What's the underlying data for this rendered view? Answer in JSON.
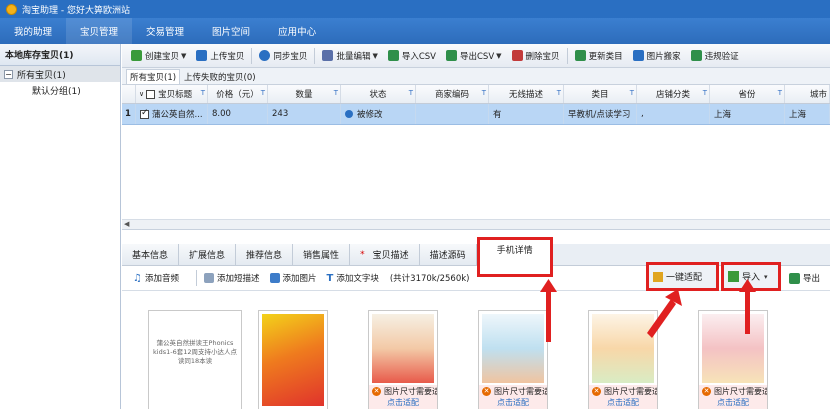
{
  "app": {
    "title": "淘宝助理 - 您好大箅欧洲站"
  },
  "menu": [
    {
      "label": "我的助理"
    },
    {
      "label": "宝贝管理"
    },
    {
      "label": "交易管理"
    },
    {
      "label": "图片空间"
    },
    {
      "label": "应用中心"
    }
  ],
  "left_panel": {
    "header": "本地库存宝贝(1)",
    "tree": {
      "root": "所有宝贝(1)",
      "root_toggle": "−",
      "child": "默认分组(1)"
    }
  },
  "toolbar": [
    {
      "label": "创建宝贝",
      "icon": "plus-icon",
      "color": "#3a9a3a"
    },
    {
      "label": "上传宝贝",
      "icon": "upload-icon",
      "color": "#2a6fc2"
    },
    {
      "label": "同步宝贝",
      "icon": "sync-icon",
      "color": "#2a6fc2"
    },
    {
      "label": "批量编辑",
      "icon": "edit-icon",
      "color": "#5a6fa8"
    },
    {
      "label": "导入CSV",
      "icon": "import-icon",
      "color": "#2f8f4a"
    },
    {
      "label": "导出CSV",
      "icon": "export-icon",
      "color": "#2f8f4a"
    },
    {
      "label": "删除宝贝",
      "icon": "delete-icon",
      "color": "#c23a3a"
    },
    {
      "label": "更新类目",
      "icon": "category-icon",
      "color": "#2f8f4a"
    },
    {
      "label": "图片搬家",
      "icon": "image-icon",
      "color": "#2a6fc2"
    },
    {
      "label": "违规验证",
      "icon": "verify-icon",
      "color": "#2f8f4a"
    }
  ],
  "subtabs": [
    {
      "label": "所有宝贝(1)"
    },
    {
      "label": "上传失败的宝贝(0)"
    }
  ],
  "grid": {
    "columns": [
      "宝贝标题",
      "价格（元）",
      "数量",
      "状态",
      "商家编码",
      "无线描述",
      "类目",
      "店铺分类",
      "省份",
      "城市"
    ],
    "row_index": "1",
    "rows": [
      [
        "蒲公英自然...",
        "8.00",
        "243",
        "被修改",
        "",
        "有",
        "早教机/点读学习",
        ",",
        "上海",
        "上海"
      ]
    ]
  },
  "detail_tabs": [
    {
      "label": "基本信息"
    },
    {
      "label": "扩展信息"
    },
    {
      "label": "推荐信息"
    },
    {
      "label": "销售属性"
    },
    {
      "label": "宝贝描述",
      "star": "*"
    },
    {
      "label": "描述源码"
    },
    {
      "label": "手机详情"
    }
  ],
  "detail_toolbar": {
    "add_audio": "添加音频",
    "add_short_desc": "添加短描述",
    "add_image": "添加图片",
    "add_text": "添加文字块",
    "counter": "(共计3170k/2560k)",
    "auto_fit": "一键适配",
    "import": "导入",
    "export": "导出"
  },
  "thumbs": {
    "placeholder_text": "蒲公英自然拼读王Phonics kids1-6套12周支持小达人点读同18本读",
    "warning": "图片尺寸需要适配",
    "fix_link": "点击适配"
  },
  "colors": {
    "titlebar": "#2a6fc2",
    "highlight": "#e02020",
    "row_selected": "#b9d6f5"
  }
}
